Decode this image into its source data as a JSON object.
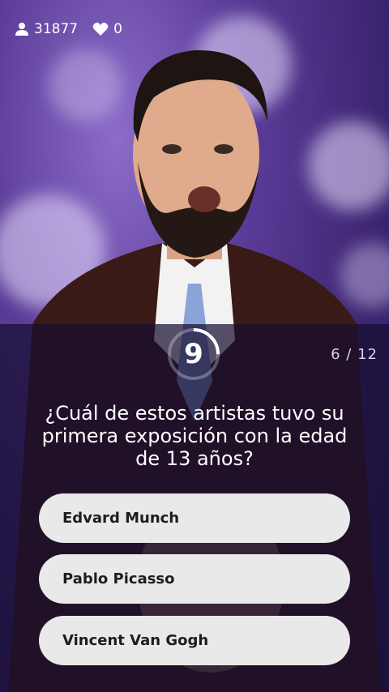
{
  "header": {
    "viewers": "31877",
    "likes": "0",
    "icons": [
      "user-icon",
      "heart-icon"
    ]
  },
  "quiz": {
    "timer": "9",
    "timer_fraction_remaining": 0.75,
    "progress": "6 / 12",
    "question": "¿Cuál de estos artistas tuvo su primera exposición con la edad de 13 años?",
    "answers": [
      {
        "label": "Edvard Munch"
      },
      {
        "label": "Pablo Picasso"
      },
      {
        "label": "Vincent Van Gogh"
      }
    ]
  },
  "colors": {
    "background": "#4a2f85",
    "panel": "#160e30",
    "answer_bg": "#e9e9e9",
    "answer_text": "#1d1d1d",
    "accent": "#ffffff"
  }
}
